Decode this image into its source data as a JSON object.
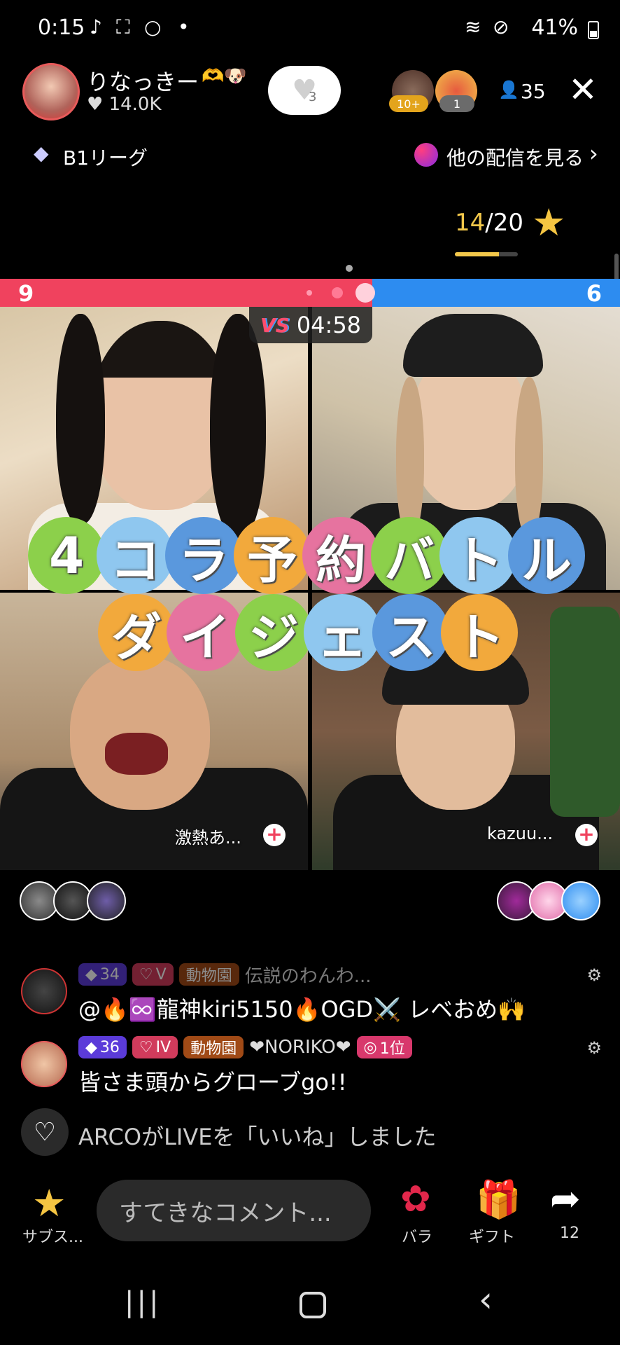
{
  "status_bar": {
    "time": "0:15",
    "icons": [
      "tiktok-icon",
      "screenshot-icon",
      "search-icon",
      "dot"
    ],
    "battery": "41%"
  },
  "header": {
    "host_name": "りなっきー",
    "host_name_deco": "🫶🐶",
    "likes": "14.0K",
    "follow_count": "3",
    "viewer_badges": [
      "10+",
      "1"
    ],
    "viewer_count": "35",
    "league": "B1リーグ",
    "other_streams": "他の配信を見る"
  },
  "goal": {
    "current": "14",
    "total": "/20",
    "fraction": 0.7
  },
  "battle": {
    "score_left": "9",
    "score_right": "6",
    "timer": "04:58",
    "vs_label": "VS",
    "left_share": 0.6
  },
  "title_overlay": {
    "line1": [
      "4",
      "コ",
      "ラ",
      "予",
      "約",
      "バ",
      "ト",
      "ル"
    ],
    "line2": [
      "ダ",
      "イ",
      "ジ",
      "ェ",
      "ス",
      "ト"
    ]
  },
  "tiles": {
    "bottom_left_name": "激熱あ...",
    "bottom_right_name": "kazuu..."
  },
  "comments": [
    {
      "badges": [
        "34",
        "V",
        "動物園"
      ],
      "name_extra": "伝説のわんわ...",
      "text": "@🔥♾️龍神kiri5150🔥OGD⚔️ レベおめ🙌"
    },
    {
      "badges": [
        "36",
        "IV",
        "動物園"
      ],
      "name_extra": "❤NORIKO❤",
      "rank": "1位",
      "text": "皆さま頭からグローブgo!!"
    }
  ],
  "like_notice": "ARCOがLIVEを「いいね」しました",
  "bottom_bar": {
    "subscribe_label": "サブス...",
    "comment_placeholder": "すてきなコメント...",
    "rose_label": "バラ",
    "gift_label": "ギフト",
    "share_count": "12"
  },
  "colors": {
    "battle_red": "#f0425e",
    "battle_blue": "#2d8cf0",
    "goal_yellow": "#f3c84b"
  }
}
